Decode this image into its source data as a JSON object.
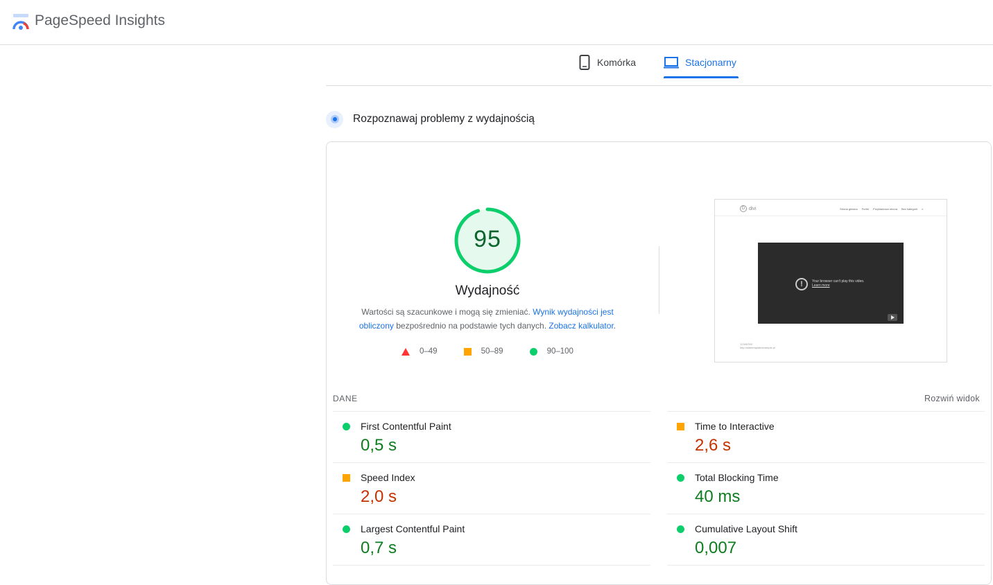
{
  "app": {
    "title": "PageSpeed Insights"
  },
  "tabs": [
    {
      "label": "Komórka",
      "active": false,
      "icon": "phone-icon"
    },
    {
      "label": "Stacjonarny",
      "active": true,
      "icon": "laptop-icon"
    }
  ],
  "section": {
    "title": "Rozpoznawaj problemy z wydajnością",
    "icon": "lighthouse-icon"
  },
  "score": {
    "value": "95",
    "fraction": 0.95,
    "label": "Wydajność",
    "color": "#0cce6b"
  },
  "description": {
    "text1": "Wartości są szacunkowe i mogą się zmieniać. ",
    "link1": "Wynik wydajności jest obliczony",
    "text2": " bezpośrednio na podstawie tych danych. ",
    "link2": "Zobacz kalkulator",
    "text3": "."
  },
  "legend": [
    {
      "range": "0–49",
      "shape": "triangle",
      "color": "#ff3333"
    },
    {
      "range": "50–89",
      "shape": "square",
      "color": "#ffa400"
    },
    {
      "range": "90–100",
      "shape": "circle",
      "color": "#0cce6b"
    }
  ],
  "screenshot": {
    "logo": "divi",
    "nav": [
      "Strona główna",
      "Porfel",
      "Przykładowa strona",
      "Bez kategorii"
    ],
    "video_message": "Your browser can't play this video.",
    "video_link": "Learn more",
    "footer_line1": "12345789",
    "footer_line2": "http://sitetemplateexample.pl"
  },
  "metrics_header": {
    "label": "DANE",
    "expand": "Rozwiń widok"
  },
  "metrics": [
    {
      "name": "First Contentful Paint",
      "value": "0,5 s",
      "status": "good"
    },
    {
      "name": "Time to Interactive",
      "value": "2,6 s",
      "status": "average"
    },
    {
      "name": "Speed Index",
      "value": "2,0 s",
      "status": "average"
    },
    {
      "name": "Total Blocking Time",
      "value": "40 ms",
      "status": "good"
    },
    {
      "name": "Largest Contentful Paint",
      "value": "0,7 s",
      "status": "good"
    },
    {
      "name": "Cumulative Layout Shift",
      "value": "0,007",
      "status": "good"
    }
  ]
}
